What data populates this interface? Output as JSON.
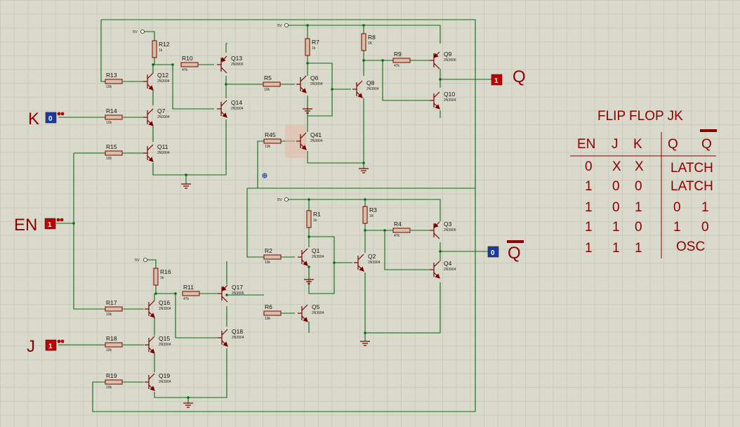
{
  "title": "FLIP FLOP JK",
  "table": {
    "headers": [
      "EN",
      "J",
      "K",
      "Q",
      "Q"
    ],
    "rows": [
      [
        "0",
        "X",
        "X",
        "LATCH"
      ],
      [
        "1",
        "0",
        "0",
        "LATCH"
      ],
      [
        "1",
        "0",
        "1",
        "0",
        "1"
      ],
      [
        "1",
        "1",
        "0",
        "1",
        "0"
      ],
      [
        "1",
        "1",
        "1",
        "OSC"
      ]
    ]
  },
  "terminals": {
    "K": {
      "label": "K",
      "value": "0"
    },
    "EN": {
      "label": "EN",
      "value": "1"
    },
    "J": {
      "label": "J",
      "value": "1"
    },
    "Q": {
      "label": "Q",
      "value": "1"
    },
    "QN": {
      "label": "Q",
      "value": "0"
    }
  },
  "supply": "5V",
  "colors": {
    "wire": "#0b6b14",
    "component": "#7a0000",
    "label": "#8b0000",
    "probe_high": "#c00000",
    "probe_low": "#1a3aa0",
    "background": "#d9d9cc"
  },
  "resistors": [
    {
      "name": "R12",
      "value": "1k"
    },
    {
      "name": "R10",
      "value": "47k"
    },
    {
      "name": "R13",
      "value": "10k"
    },
    {
      "name": "R14",
      "value": "10k"
    },
    {
      "name": "R15",
      "value": "10k"
    },
    {
      "name": "R7",
      "value": "1k"
    },
    {
      "name": "R8",
      "value": "1K"
    },
    {
      "name": "R9",
      "value": "47k"
    },
    {
      "name": "R5",
      "value": "10k"
    },
    {
      "name": "R45",
      "value": "10k"
    },
    {
      "name": "R1",
      "value": "1k"
    },
    {
      "name": "R3",
      "value": "1K"
    },
    {
      "name": "R4",
      "value": "47k"
    },
    {
      "name": "R2",
      "value": "10k"
    },
    {
      "name": "R6",
      "value": "10k"
    },
    {
      "name": "R16",
      "value": "1k"
    },
    {
      "name": "R11",
      "value": "47k"
    },
    {
      "name": "R17",
      "value": "10k"
    },
    {
      "name": "R18",
      "value": "10k"
    },
    {
      "name": "R19",
      "value": "10k"
    }
  ],
  "transistors": [
    {
      "name": "Q12",
      "type": "2N3904"
    },
    {
      "name": "Q13",
      "type": "2N3906"
    },
    {
      "name": "Q7",
      "type": "2N3904"
    },
    {
      "name": "Q14",
      "type": "2N3904"
    },
    {
      "name": "Q11",
      "type": "2N3904"
    },
    {
      "name": "Q6",
      "type": "2N3904"
    },
    {
      "name": "Q8",
      "type": "2N3904"
    },
    {
      "name": "Q9",
      "type": "2N3906"
    },
    {
      "name": "Q10",
      "type": "2N3904"
    },
    {
      "name": "Q41",
      "type": "2N3904"
    },
    {
      "name": "Q1",
      "type": "2N3904"
    },
    {
      "name": "Q2",
      "type": "2N3904"
    },
    {
      "name": "Q3",
      "type": "2N3906"
    },
    {
      "name": "Q4",
      "type": "2N3904"
    },
    {
      "name": "Q5",
      "type": "2N3904"
    },
    {
      "name": "Q16",
      "type": "2N3904"
    },
    {
      "name": "Q17",
      "type": "2N3906"
    },
    {
      "name": "Q15",
      "type": "2N3904"
    },
    {
      "name": "Q18",
      "type": "2N3904"
    },
    {
      "name": "Q19",
      "type": "2N3904"
    }
  ]
}
